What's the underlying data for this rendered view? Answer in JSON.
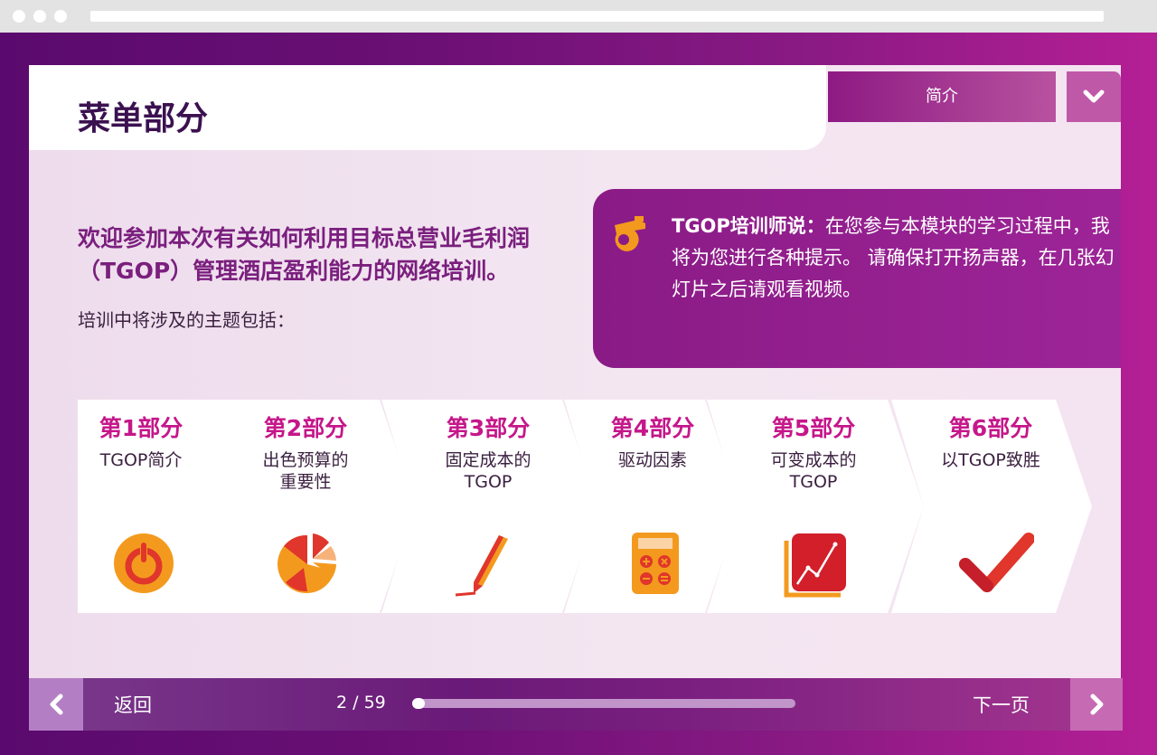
{
  "header": {
    "title": "菜单部分",
    "menu_label": "简介",
    "dropdown_icon": "chevron-down-icon"
  },
  "intro": {
    "heading": "欢迎参加本次有关如何利用目标总营业毛利润（TGOP）管理酒店盈利能力的网络培训。",
    "topics_label": "培训中将涉及的主题包括："
  },
  "trainer": {
    "label": "TGOP培训师说：",
    "message": "在您参与本模块的学习过程中，我将为您进行各种提示。 请确保打开扬声器，在几张幻灯片之后请观看视频。",
    "icon": "whistle-icon"
  },
  "sections": [
    {
      "heading": "第1部分",
      "line1": "TGOP简介",
      "line2": "",
      "icon": "power-icon"
    },
    {
      "heading": "第2部分",
      "line1": "出色预算的",
      "line2": "重要性",
      "icon": "pie-chart-icon"
    },
    {
      "heading": "第3部分",
      "line1": "固定成本的",
      "line2": "TGOP",
      "icon": "pen-icon"
    },
    {
      "heading": "第4部分",
      "line1": "驱动因素",
      "line2": "",
      "icon": "calculator-icon"
    },
    {
      "heading": "第5部分",
      "line1": "可变成本的",
      "line2": "TGOP",
      "icon": "line-chart-icon"
    },
    {
      "heading": "第6部分",
      "line1": "以TGOP致胜",
      "line2": "",
      "icon": "checkmark-icon"
    }
  ],
  "nav": {
    "back_label": "返回",
    "page_indicator": "2 / 59",
    "progress_fraction": 0.034,
    "next_label": "下一页"
  },
  "colors": {
    "accent_purple": "#8a1b86",
    "section_heading": "#c5178a",
    "icon_orange": "#f39a1e",
    "icon_red": "#e0362b"
  }
}
